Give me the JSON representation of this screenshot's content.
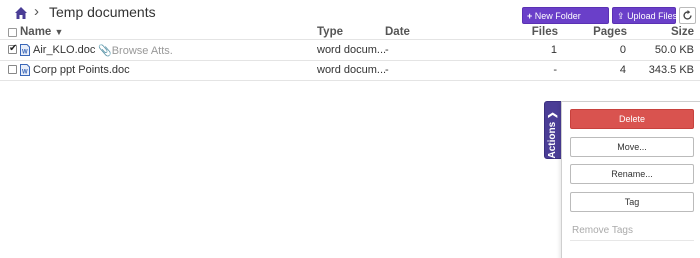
{
  "breadcrumb": {
    "title": "Temp documents"
  },
  "toolbar": {
    "new_folder_label": "New Folder",
    "upload_files_label": "Upload Files"
  },
  "table": {
    "headers": {
      "name": "Name",
      "type": "Type",
      "date": "Date",
      "files": "Files",
      "pages": "Pages",
      "size": "Size"
    },
    "rows": [
      {
        "checked": true,
        "name": "Air_KLO.doc",
        "extra": "Browse Atts.",
        "type": "word docum...",
        "date": "-",
        "files": "1",
        "pages": "0",
        "size": "50.0 KB"
      },
      {
        "checked": false,
        "name": "Corp ppt Points.doc",
        "extra": "",
        "type": "word docum...",
        "date": "-",
        "files": "-",
        "pages": "4",
        "size": "343.5 KB"
      }
    ]
  },
  "actions": {
    "tab_label": "Actions",
    "delete": "Delete",
    "move": "Move...",
    "rename": "Rename...",
    "tag": "Tag",
    "remove_tags": "Remove Tags"
  },
  "colors": {
    "accent": "#6a3fc9",
    "actions_tab": "#4a3d96",
    "delete": "#d9534f"
  }
}
